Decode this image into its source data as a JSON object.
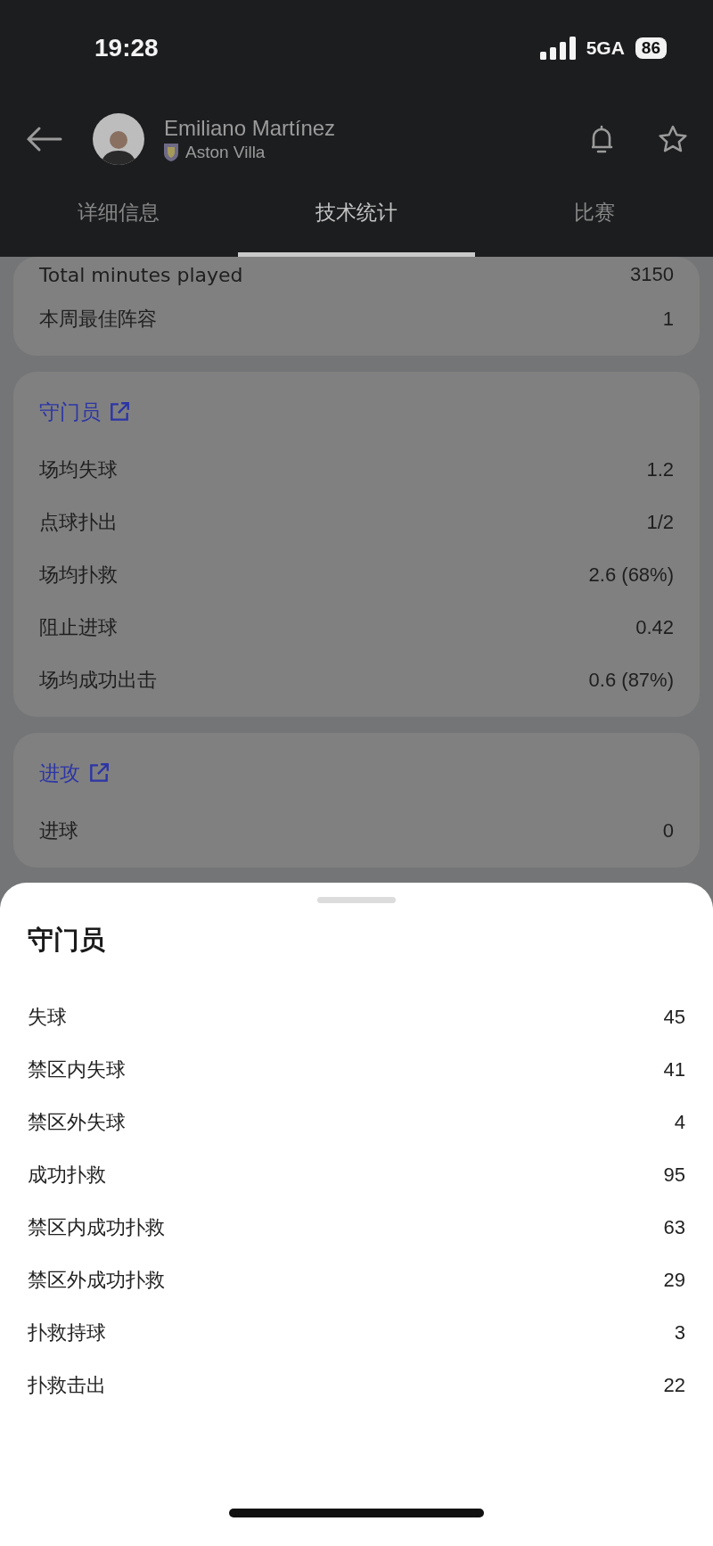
{
  "status_bar": {
    "time": "19:28",
    "network": "5GA",
    "battery": "86"
  },
  "header": {
    "player_name": "Emiliano Martínez",
    "team": "Aston Villa"
  },
  "tabs": [
    {
      "label": "详细信息",
      "selected": false
    },
    {
      "label": "技术统计",
      "selected": true
    },
    {
      "label": "比赛",
      "selected": false
    }
  ],
  "sections": [
    {
      "rows": [
        {
          "label": "Total minutes played",
          "value": "3150"
        },
        {
          "label": "本周最佳阵容",
          "value": "1"
        }
      ]
    },
    {
      "title": "守门员",
      "rows": [
        {
          "label": "场均失球",
          "value": "1.2"
        },
        {
          "label": "点球扑出",
          "value": "1/2"
        },
        {
          "label": "场均扑救",
          "value": "2.6 (68%)"
        },
        {
          "label": "阻止进球",
          "value": "0.42"
        },
        {
          "label": "场均成功出击",
          "value": "0.6 (87%)"
        }
      ]
    },
    {
      "title": "进攻",
      "rows": [
        {
          "label": "进球",
          "value": "0"
        }
      ]
    }
  ],
  "sheet": {
    "title": "守门员",
    "rows": [
      {
        "label": "失球",
        "value": "45"
      },
      {
        "label": "禁区内失球",
        "value": "41"
      },
      {
        "label": "禁区外失球",
        "value": "4"
      },
      {
        "label": "成功扑救",
        "value": "95"
      },
      {
        "label": "禁区内成功扑救",
        "value": "63"
      },
      {
        "label": "禁区外成功扑救",
        "value": "29"
      },
      {
        "label": "扑救持球",
        "value": "3"
      },
      {
        "label": "扑救击出",
        "value": "22"
      }
    ]
  }
}
